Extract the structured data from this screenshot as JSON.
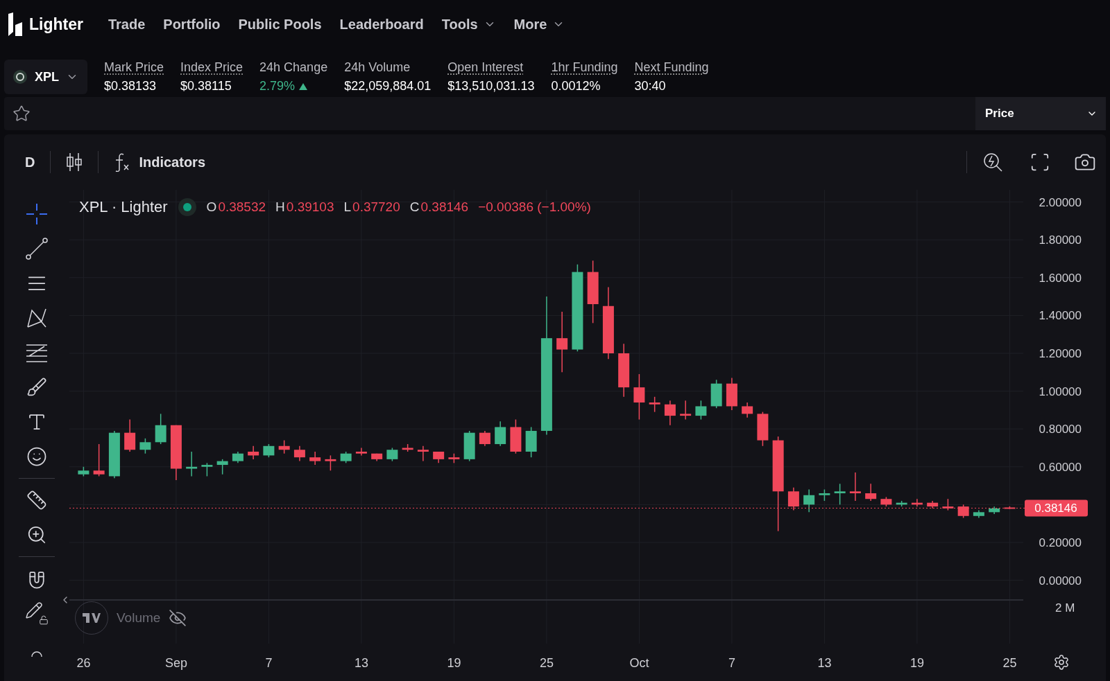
{
  "nav": {
    "brand": "Lighter",
    "items": [
      {
        "label": "Trade",
        "dropdown": false
      },
      {
        "label": "Portfolio",
        "dropdown": false
      },
      {
        "label": "Public Pools",
        "dropdown": false
      },
      {
        "label": "Leaderboard",
        "dropdown": false
      },
      {
        "label": "Tools",
        "dropdown": true
      },
      {
        "label": "More",
        "dropdown": true
      }
    ]
  },
  "market": {
    "symbol": "XPL",
    "stats": [
      {
        "label": "Mark Price",
        "value": "$0.38133",
        "underlined": true
      },
      {
        "label": "Index Price",
        "value": "$0.38115",
        "underlined": true
      },
      {
        "label": "24h Change",
        "value": "2.79%",
        "underlined": false,
        "rising": true
      },
      {
        "label": "24h Volume",
        "value": "$22,059,884.01",
        "underlined": false
      },
      {
        "label": "Open Interest",
        "value": "$13,510,031.13",
        "underlined": true
      },
      {
        "label": "1hr Funding",
        "value": "0.0012%",
        "underlined": true
      },
      {
        "label": "Next Funding",
        "value": "30:40",
        "underlined": true
      }
    ]
  },
  "favorite": {
    "starred": false
  },
  "view_select": {
    "value": "Price"
  },
  "chart_toolbar": {
    "interval": "D",
    "indicators": "Indicators"
  },
  "legend": {
    "title": "XPL · Lighter",
    "falling": true,
    "ohlc": [
      {
        "key": "O",
        "value": "0.38532"
      },
      {
        "key": "H",
        "value": "0.39103"
      },
      {
        "key": "L",
        "value": "0.37720"
      },
      {
        "key": "C",
        "value": "0.38146"
      }
    ],
    "change": "−0.00386 (−1.00%)"
  },
  "volume": {
    "label": "Volume",
    "visible": false,
    "axis_label": "2 M"
  },
  "chart_data": {
    "type": "candlestick",
    "grid": true,
    "ylim": [
      0,
      2
    ],
    "categories": [
      "26",
      null,
      null,
      null,
      null,
      null,
      "Sep",
      null,
      null,
      null,
      null,
      null,
      "7",
      null,
      null,
      null,
      null,
      null,
      "13",
      null,
      null,
      null,
      null,
      null,
      "19",
      null,
      null,
      null,
      null,
      null,
      "25",
      null,
      null,
      null,
      null,
      null,
      "Oct",
      null,
      null,
      null,
      null,
      null,
      "7",
      null,
      null,
      null,
      null,
      null,
      "13",
      null,
      null,
      null,
      null,
      null,
      "19",
      null,
      null,
      null,
      null,
      null,
      "25"
    ],
    "ohlc": [
      [
        0.56,
        0.6,
        0.55,
        0.58
      ],
      [
        0.58,
        0.72,
        0.55,
        0.56
      ],
      [
        0.55,
        0.79,
        0.54,
        0.78
      ],
      [
        0.78,
        0.85,
        0.68,
        0.69
      ],
      [
        0.69,
        0.75,
        0.67,
        0.73
      ],
      [
        0.73,
        0.88,
        0.72,
        0.82
      ],
      [
        0.82,
        0.82,
        0.53,
        0.59
      ],
      [
        0.59,
        0.68,
        0.55,
        0.6
      ],
      [
        0.6,
        0.62,
        0.55,
        0.61
      ],
      [
        0.61,
        0.64,
        0.56,
        0.63
      ],
      [
        0.63,
        0.68,
        0.62,
        0.67
      ],
      [
        0.68,
        0.71,
        0.64,
        0.66
      ],
      [
        0.66,
        0.72,
        0.65,
        0.71
      ],
      [
        0.71,
        0.74,
        0.67,
        0.69
      ],
      [
        0.69,
        0.71,
        0.63,
        0.65
      ],
      [
        0.65,
        0.68,
        0.61,
        0.63
      ],
      [
        0.64,
        0.66,
        0.58,
        0.63
      ],
      [
        0.63,
        0.68,
        0.62,
        0.67
      ],
      [
        0.68,
        0.7,
        0.66,
        0.67
      ],
      [
        0.67,
        0.67,
        0.63,
        0.64
      ],
      [
        0.64,
        0.7,
        0.63,
        0.69
      ],
      [
        0.7,
        0.72,
        0.68,
        0.69
      ],
      [
        0.69,
        0.71,
        0.63,
        0.68
      ],
      [
        0.68,
        0.68,
        0.62,
        0.64
      ],
      [
        0.65,
        0.67,
        0.62,
        0.64
      ],
      [
        0.64,
        0.79,
        0.63,
        0.78
      ],
      [
        0.78,
        0.79,
        0.71,
        0.72
      ],
      [
        0.72,
        0.84,
        0.71,
        0.81
      ],
      [
        0.81,
        0.85,
        0.67,
        0.68
      ],
      [
        0.68,
        0.81,
        0.65,
        0.79
      ],
      [
        0.79,
        1.5,
        0.77,
        1.28
      ],
      [
        1.28,
        1.42,
        1.1,
        1.22
      ],
      [
        1.22,
        1.67,
        1.21,
        1.63
      ],
      [
        1.63,
        1.69,
        1.36,
        1.46
      ],
      [
        1.45,
        1.55,
        1.17,
        1.2
      ],
      [
        1.2,
        1.25,
        0.97,
        1.02
      ],
      [
        1.02,
        1.09,
        0.85,
        0.94
      ],
      [
        0.94,
        0.97,
        0.89,
        0.93
      ],
      [
        0.93,
        0.95,
        0.82,
        0.87
      ],
      [
        0.88,
        0.95,
        0.85,
        0.87
      ],
      [
        0.87,
        0.95,
        0.85,
        0.92
      ],
      [
        0.92,
        1.06,
        0.91,
        1.04
      ],
      [
        1.04,
        1.07,
        0.9,
        0.92
      ],
      [
        0.92,
        0.94,
        0.86,
        0.88
      ],
      [
        0.88,
        0.89,
        0.71,
        0.74
      ],
      [
        0.74,
        0.76,
        0.26,
        0.47
      ],
      [
        0.47,
        0.49,
        0.37,
        0.39
      ],
      [
        0.4,
        0.48,
        0.36,
        0.45
      ],
      [
        0.45,
        0.48,
        0.42,
        0.46
      ],
      [
        0.46,
        0.51,
        0.4,
        0.47
      ],
      [
        0.47,
        0.57,
        0.42,
        0.46
      ],
      [
        0.46,
        0.51,
        0.42,
        0.43
      ],
      [
        0.43,
        0.44,
        0.39,
        0.4
      ],
      [
        0.4,
        0.42,
        0.39,
        0.41
      ],
      [
        0.41,
        0.43,
        0.39,
        0.4
      ],
      [
        0.41,
        0.42,
        0.38,
        0.39
      ],
      [
        0.39,
        0.43,
        0.37,
        0.38
      ],
      [
        0.39,
        0.4,
        0.33,
        0.34
      ],
      [
        0.34,
        0.37,
        0.33,
        0.36
      ],
      [
        0.36,
        0.39,
        0.35,
        0.38
      ],
      [
        0.385,
        0.391,
        0.377,
        0.381
      ]
    ],
    "ref_lines": [
      {
        "axis": "y",
        "value": 0.38146,
        "label": "0.38146",
        "color": "#f0475a"
      }
    ],
    "yticks": [
      {
        "value": 0,
        "label": "0.00000"
      },
      {
        "value": 0.2,
        "label": "0.20000"
      },
      {
        "value": 0.6,
        "label": "0.60000"
      },
      {
        "value": 0.8,
        "label": "0.80000"
      },
      {
        "value": 1,
        "label": "1.00000"
      },
      {
        "value": 1.2,
        "label": "1.20000"
      },
      {
        "value": 1.4,
        "label": "1.40000"
      },
      {
        "value": 1.6,
        "label": "1.60000"
      },
      {
        "value": 1.8,
        "label": "1.80000"
      },
      {
        "value": 2,
        "label": "2.00000"
      }
    ]
  }
}
